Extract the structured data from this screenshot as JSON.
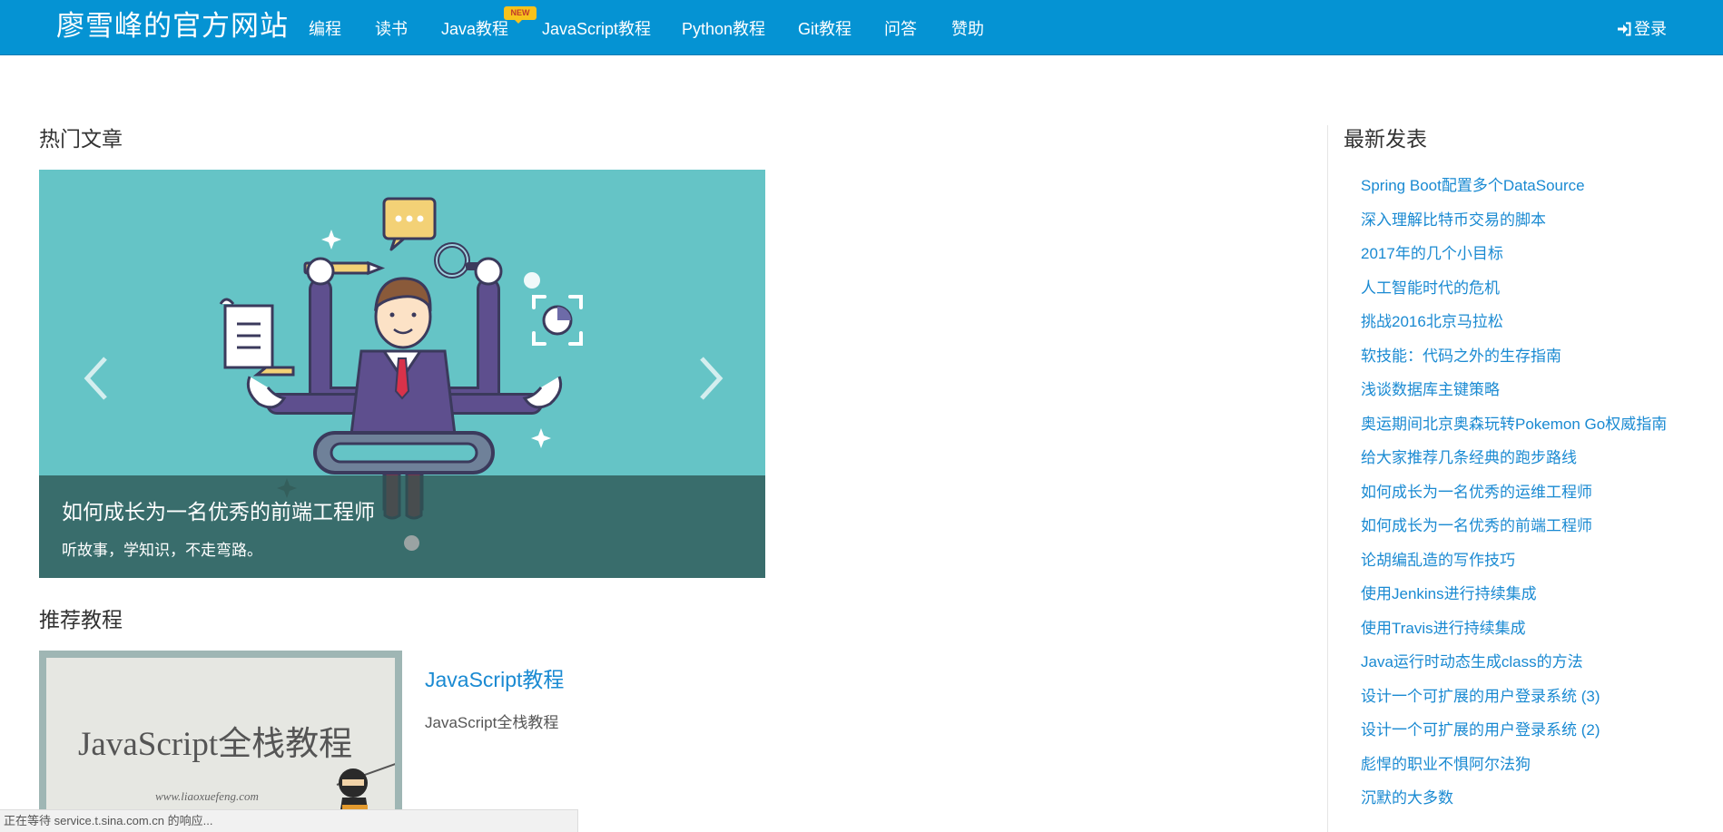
{
  "navbar": {
    "brand": "廖雪峰的官方网站",
    "items": [
      "编程",
      "读书",
      "Java教程",
      "JavaScript教程",
      "Python教程",
      "Git教程",
      "问答",
      "赞助"
    ],
    "new_badge": "NEW",
    "login": "登录",
    "bg_color": "#0593d3"
  },
  "hot": {
    "title": "热门文章",
    "slide_title": "如何成长为一名优秀的前端工程师",
    "slide_subtitle": "听故事，学知识，不走弯路。"
  },
  "recommended": {
    "title": "推荐教程",
    "cover_title": "JavaScript全栈教程",
    "cover_url": "www.liaoxuefeng.com",
    "link": "JavaScript教程",
    "desc": "JavaScript全栈教程"
  },
  "latest": {
    "title": "最新发表",
    "items": [
      "Spring Boot配置多个DataSource",
      "深入理解比特币交易的脚本",
      "2017年的几个小目标",
      "人工智能时代的危机",
      "挑战2016北京马拉松",
      "软技能：代码之外的生存指南",
      "浅谈数据库主键策略",
      "奥运期间北京奥森玩转Pokemon Go权威指南",
      "给大家推荐几条经典的跑步路线",
      "如何成长为一名优秀的运维工程师",
      "如何成长为一名优秀的前端工程师",
      "论胡编乱造的写作技巧",
      "使用Jenkins进行持续集成",
      "使用Travis进行持续集成",
      "Java运行时动态生成class的方法",
      "设计一个可扩展的用户登录系统 (3)",
      "设计一个可扩展的用户登录系统 (2)",
      "彪悍的职业不惧阿尔法狗",
      "沉默的大多数"
    ],
    "link_color": "#1a8ad2"
  },
  "status_bar": "正在等待 service.t.sina.com.cn 的响应..."
}
